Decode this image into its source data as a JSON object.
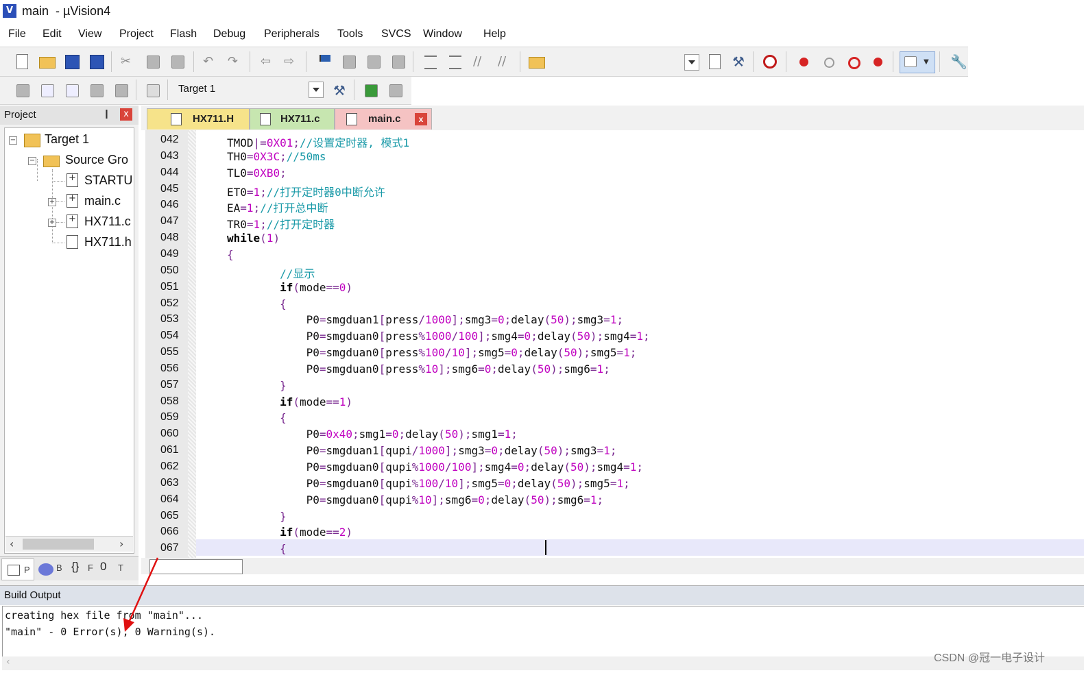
{
  "window": {
    "title": "main  - µVision4",
    "icon": "V"
  },
  "menu": [
    "File",
    "Edit",
    "View",
    "Project",
    "Flash",
    "Debug",
    "Peripherals",
    "Tools",
    "SVCS",
    "Window",
    "Help"
  ],
  "toolbar2": {
    "target": "Target 1"
  },
  "project": {
    "title": "Project",
    "pin": "❙",
    "close": "x",
    "tree": [
      {
        "label": "Target 1"
      },
      {
        "label": "Source Gro"
      },
      {
        "label": "STARTU"
      },
      {
        "label": "main.c"
      },
      {
        "label": "HX711.c"
      },
      {
        "label": "HX711.h"
      }
    ],
    "bottom_tabs": [
      "P",
      "B",
      "F",
      "T"
    ]
  },
  "editor": {
    "tabs": [
      {
        "label": "HX711.H"
      },
      {
        "label": "HX711.c"
      },
      {
        "label": "main.c",
        "active": true
      }
    ],
    "close": "x",
    "lines": [
      {
        "no": "042",
        "text": "TMOD|=0X01;//设置定时器, 模式1"
      },
      {
        "no": "043",
        "text": "TH0=0X3C;//50ms"
      },
      {
        "no": "044",
        "text": "TL0=0XB0;"
      },
      {
        "no": "045",
        "text": "ET0=1;//打开定时器0中断允许"
      },
      {
        "no": "046",
        "text": "EA=1;//打开总中断"
      },
      {
        "no": "047",
        "text": "TR0=1;//打开定时器"
      },
      {
        "no": "048",
        "text": "while(1)"
      },
      {
        "no": "049",
        "text": "{"
      },
      {
        "no": "050",
        "text": "        //显示"
      },
      {
        "no": "051",
        "text": "        if(mode==0)"
      },
      {
        "no": "052",
        "text": "        {"
      },
      {
        "no": "053",
        "text": "            P0=smgduan1[press/1000];smg3=0;delay(50);smg3=1;"
      },
      {
        "no": "054",
        "text": "            P0=smgduan0[press%1000/100];smg4=0;delay(50);smg4=1;"
      },
      {
        "no": "055",
        "text": "            P0=smgduan0[press%100/10];smg5=0;delay(50);smg5=1;"
      },
      {
        "no": "056",
        "text": "            P0=smgduan0[press%10];smg6=0;delay(50);smg6=1;"
      },
      {
        "no": "057",
        "text": "        }"
      },
      {
        "no": "058",
        "text": "        if(mode==1)"
      },
      {
        "no": "059",
        "text": "        {"
      },
      {
        "no": "060",
        "text": "            P0=0x40;smg1=0;delay(50);smg1=1;"
      },
      {
        "no": "061",
        "text": "            P0=smgduan1[qupi/1000];smg3=0;delay(50);smg3=1;"
      },
      {
        "no": "062",
        "text": "            P0=smgduan0[qupi%1000/100];smg4=0;delay(50);smg4=1;"
      },
      {
        "no": "063",
        "text": "            P0=smgduan0[qupi%100/10];smg5=0;delay(50);smg5=1;"
      },
      {
        "no": "064",
        "text": "            P0=smgduan0[qupi%10];smg6=0;delay(50);smg6=1;"
      },
      {
        "no": "065",
        "text": "        }"
      },
      {
        "no": "066",
        "text": "        if(mode==2)"
      },
      {
        "no": "067",
        "text": "        {"
      }
    ]
  },
  "build_output": {
    "title": "Build Output",
    "lines": [
      "creating hex file from \"main\"...",
      "\"main\" - 0 Error(s), 0 Warning(s)."
    ]
  },
  "watermark": "CSDN @冠一电子设计",
  "colors": {
    "number": "#c000c0",
    "comment": "#1a9aa8",
    "keyword": "#000000",
    "punct": "#7a2a90",
    "annotation_arrow": "#e01010"
  }
}
